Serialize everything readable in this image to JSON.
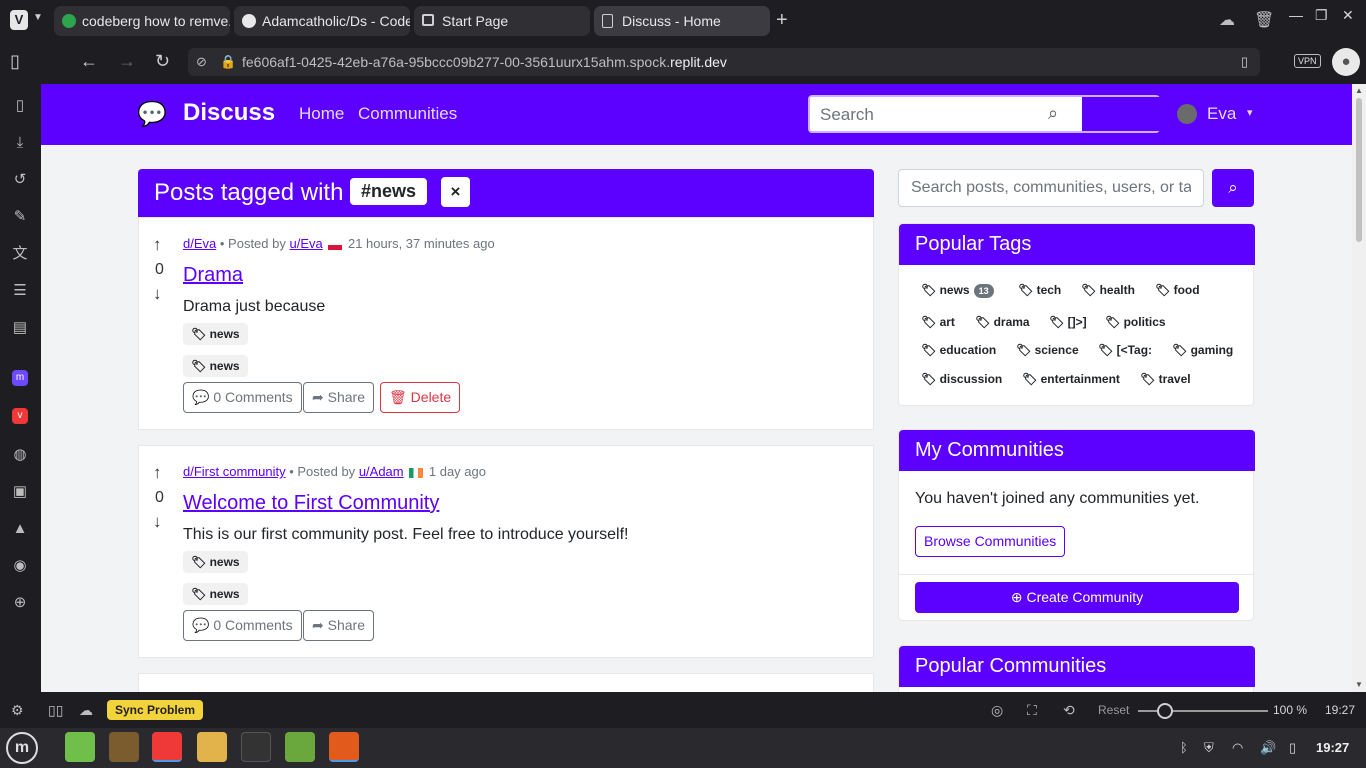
{
  "browser": {
    "tabs": [
      {
        "title": "codeberg how to remve...",
        "icon": "codeberg-icon"
      },
      {
        "title": "Adamcatholic/Ds - Code...",
        "icon": "codeberg-icon"
      },
      {
        "title": "Start Page",
        "icon": "grid-icon"
      },
      {
        "title": "Discuss - Home",
        "icon": "page-icon"
      }
    ],
    "url_prefix": "fe606af1-0425-42eb-a76a-95bccc09b277-00-3561uurx15ahm.spock.",
    "url_domain": "replit.dev",
    "vpn_label": "VPN"
  },
  "site": {
    "brand": "Discuss",
    "nav_links": [
      "Home",
      "Communities"
    ],
    "search_placeholder": "Search",
    "user_name": "Eva"
  },
  "tag_header": {
    "title": "Posts tagged with",
    "tag": "#news",
    "clear": "×"
  },
  "posts": [
    {
      "community": "d/Eva",
      "posted_by": "• Posted by",
      "author": "u/Eva",
      "time": "21 hours, 37 minutes ago",
      "score": "0",
      "title": "Drama",
      "body": "Drama just because",
      "tags": [
        "news",
        "news"
      ],
      "comments": "0 Comments",
      "share": "Share",
      "delete": "Delete"
    },
    {
      "community": "d/First community",
      "posted_by": "• Posted by",
      "author": "u/Adam",
      "time": "1 day ago",
      "score": "0",
      "title": "Welcome to First Community",
      "body": "This is our first community post. Feel free to introduce yourself!",
      "tags": [
        "news",
        "news"
      ],
      "comments": "0 Comments",
      "share": "Share"
    }
  ],
  "sidebar": {
    "search_placeholder": "Search posts, communities, users, or ta",
    "popular_tags_title": "Popular Tags",
    "popular_tags": [
      {
        "name": "news",
        "count": "13"
      },
      {
        "name": "tech"
      },
      {
        "name": "health"
      },
      {
        "name": "food"
      },
      {
        "name": "art"
      },
      {
        "name": "drama"
      },
      {
        "name": "[]>]"
      },
      {
        "name": "politics"
      },
      {
        "name": "education"
      },
      {
        "name": "science"
      },
      {
        "name": "[<Tag:"
      },
      {
        "name": "gaming"
      },
      {
        "name": "discussion"
      },
      {
        "name": "entertainment"
      },
      {
        "name": "travel"
      }
    ],
    "my_communities_title": "My Communities",
    "my_communities_text": "You haven't joined any communities yet.",
    "browse_label": "Browse Communities",
    "create_label": "Create Community",
    "popular_communities_title": "Popular Communities"
  },
  "statusbar": {
    "sync": "Sync Problem",
    "reset": "Reset",
    "zoom": "100 %",
    "time": "19:27"
  },
  "taskbar": {
    "time": "19:27"
  },
  "colors": {
    "brand": "#5c00ff",
    "danger": "#dc3545",
    "sync_warning": "#f3d33b"
  }
}
